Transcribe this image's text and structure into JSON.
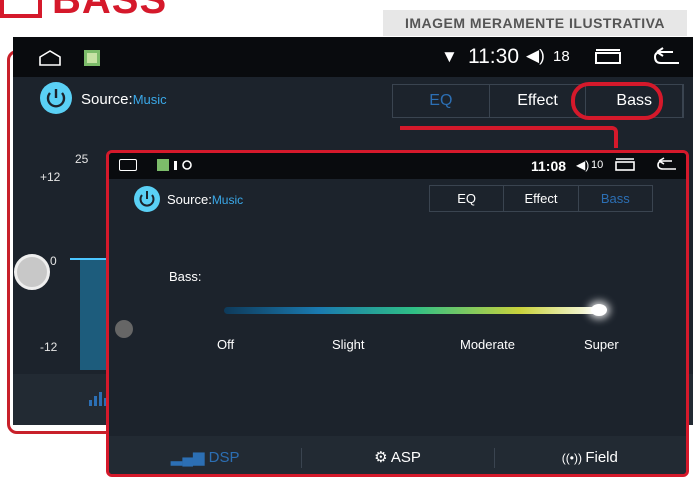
{
  "header": {
    "logo_text": "BASS",
    "disclaimer": "IMAGEM MERAMENTE ILUSTRATIVA"
  },
  "back_screen": {
    "status": {
      "time": "11:30",
      "volume": "18"
    },
    "source_label": "Source:",
    "source_value": "Music",
    "tabs": [
      "EQ",
      "Effect",
      "Bass"
    ],
    "graph_labels": {
      "top": "25",
      "plus": "+12",
      "zero": "0",
      "minus": "-12"
    }
  },
  "front_screen": {
    "status": {
      "time": "11:08",
      "volume": "10"
    },
    "source_label": "Source:",
    "source_value": "Music",
    "tabs": [
      "EQ",
      "Effect",
      "Bass"
    ],
    "active_tab": "Bass",
    "bass_label": "Bass:",
    "slider": {
      "levels": [
        "Off",
        "Slight",
        "Moderate",
        "Super"
      ],
      "selected": "Super",
      "value_fraction": 1.0
    },
    "bottom_tabs": [
      "DSP",
      "ASP",
      "Field"
    ],
    "active_bottom": "DSP"
  },
  "colors": {
    "accent": "#d5192b",
    "brand_blue": "#2c6fb4",
    "source_icon": "#5ad0f5"
  }
}
